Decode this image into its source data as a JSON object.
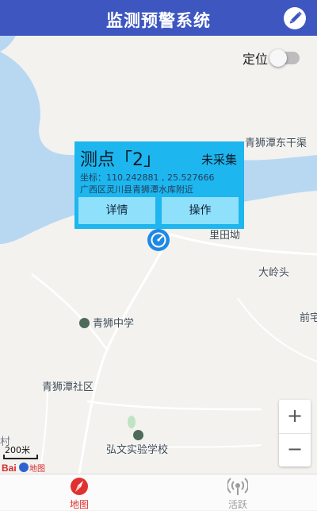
{
  "header": {
    "title": "监测预警系统",
    "edit_icon": "pencil-icon"
  },
  "map": {
    "locate": {
      "label": "定位",
      "enabled": false
    },
    "labels": {
      "place_1": "青狮潭东干渠",
      "place_2": "里田坳",
      "place_3": "大岭头",
      "place_4": "前宅",
      "school_1": "青狮中学",
      "community": "青狮潭社区",
      "school_2": "弘文实验学校",
      "village": "村"
    },
    "scale_text": "200米",
    "logo_text": "Baidu地图",
    "zoom": {
      "in": "+",
      "out": "−"
    },
    "colors": {
      "water": "#b8d8f2",
      "land": "#f3f2ef",
      "road": "#ffffff"
    }
  },
  "popup": {
    "name": "测点「2」",
    "status": "未采集",
    "coords": "坐标：110.242881 , 25.527666",
    "address": "广西区灵川县青狮潭水库附近",
    "detail_label": "详情",
    "action_label": "操作",
    "colors": {
      "background": "#1db6ee",
      "button": "#8fe0fb"
    }
  },
  "bottom_nav": {
    "items": [
      {
        "label": "地图",
        "icon": "map-compass-icon",
        "selected": true
      },
      {
        "label": "活跃",
        "icon": "broadcast-icon",
        "selected": false
      }
    ],
    "colors": {
      "selected": "#e03131",
      "unselected": "#9d9d9d"
    }
  }
}
